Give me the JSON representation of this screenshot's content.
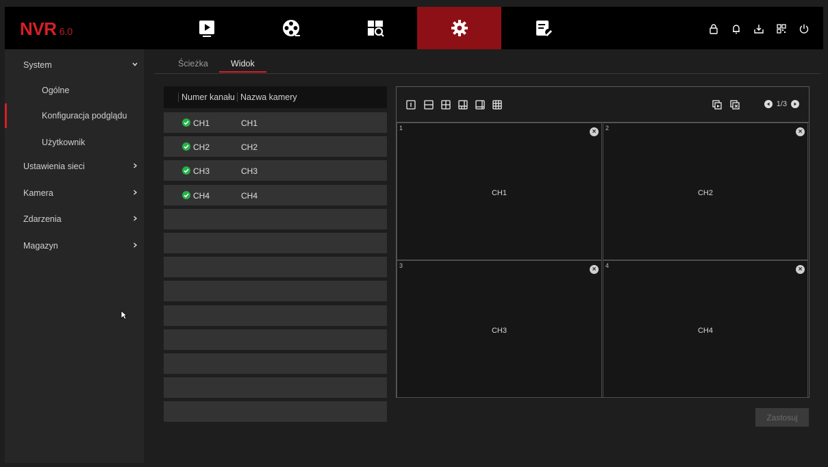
{
  "logo": {
    "brand": "NVR",
    "version": "6.0"
  },
  "nav_tabs": [
    {
      "name": "playback",
      "icon": "play-icon"
    },
    {
      "name": "film",
      "icon": "film-reel-icon"
    },
    {
      "name": "search",
      "icon": "search-grid-icon"
    },
    {
      "name": "settings",
      "icon": "gear-icon",
      "active": true
    },
    {
      "name": "maintenance",
      "icon": "tools-icon"
    }
  ],
  "top_icons": [
    "lock-icon",
    "bell-icon",
    "download-icon",
    "qr-code-icon",
    "power-icon"
  ],
  "sidebar": {
    "items": [
      {
        "label": "System",
        "chevron": "down"
      },
      {
        "label": "Ogólne",
        "sub": true
      },
      {
        "label": "Konfiguracja podglądu",
        "sub": true,
        "active": true
      },
      {
        "label": "Użytkownik",
        "sub": true
      },
      {
        "label": "Ustawienia sieci",
        "chevron": "right"
      },
      {
        "label": "Kamera",
        "chevron": "right"
      },
      {
        "label": "Zdarzenia",
        "chevron": "right"
      },
      {
        "label": "Magazyn",
        "chevron": "right"
      }
    ]
  },
  "tabs": [
    {
      "label": "Ścieżka"
    },
    {
      "label": "Widok",
      "active": true
    }
  ],
  "channel_table": {
    "headers": [
      "Numer kanału",
      "Nazwa kamery"
    ],
    "rows": [
      {
        "channel": "CH1",
        "name": "CH1"
      },
      {
        "channel": "CH2",
        "name": "CH2"
      },
      {
        "channel": "CH3",
        "name": "CH3"
      },
      {
        "channel": "CH4",
        "name": "CH4"
      }
    ],
    "empty_rows": 9
  },
  "preview": {
    "page": "1/3",
    "cells": [
      {
        "num": "1",
        "label": "CH1"
      },
      {
        "num": "2",
        "label": "CH2"
      },
      {
        "num": "3",
        "label": "CH3"
      },
      {
        "num": "4",
        "label": "CH4"
      }
    ]
  },
  "apply_label": "Zastosuj",
  "colors": {
    "accent": "#d61f26",
    "active_tab": "#8d1016",
    "ok_green": "#27b14a"
  }
}
